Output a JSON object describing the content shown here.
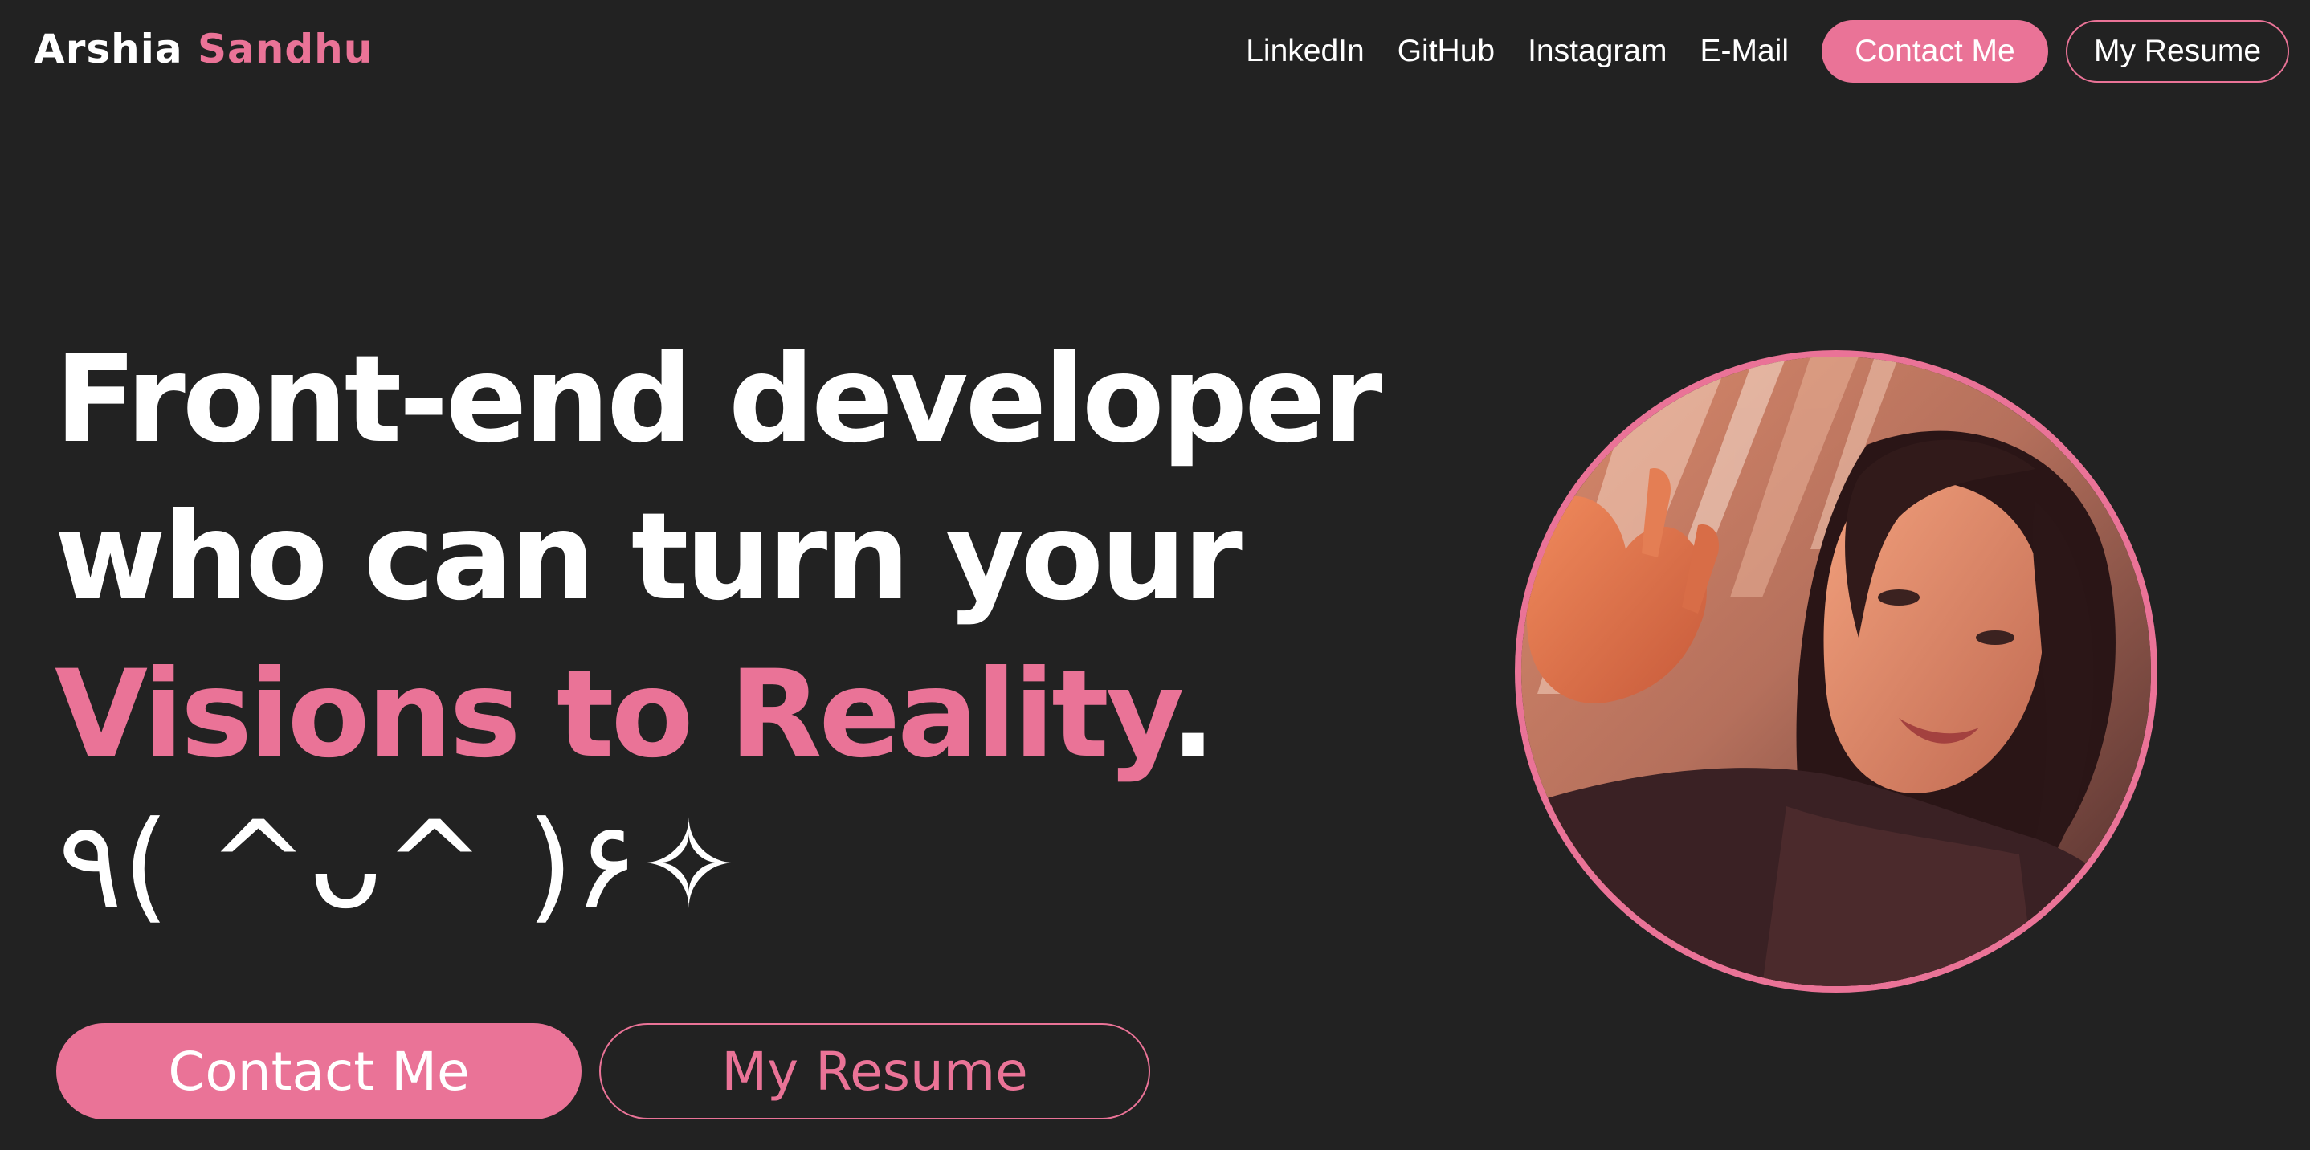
{
  "brand": {
    "first_name": "Arshia",
    "last_name": "Sandhu",
    "accent_color": "#ea7397",
    "background_color": "#222222"
  },
  "nav": {
    "links": [
      "LinkedIn",
      "GitHub",
      "Instagram",
      "E-Mail"
    ],
    "contact_label": "Contact Me",
    "resume_label": "My Resume"
  },
  "hero": {
    "line1": "Front-end developer",
    "line2": "who can turn your",
    "line3_accent": "Visions to Reality",
    "line3_end": ".",
    "kaomoji": "٩( ^ᴗ^ )۶✧",
    "contact_label": "Contact Me",
    "resume_label": "My Resume"
  },
  "portrait": {
    "icon": "profile-photo"
  }
}
